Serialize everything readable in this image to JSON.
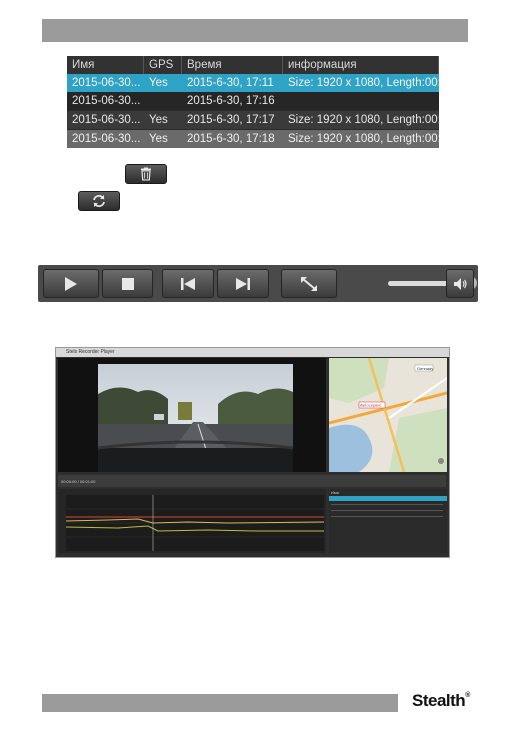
{
  "table": {
    "columns": [
      "Имя",
      "GPS",
      "Время",
      "информация"
    ],
    "rows": [
      {
        "name": "2015-06-30...",
        "gps": "Yes",
        "time": "2015-6-30, 17:11",
        "info": "Size: 1920 x 1080, Length:00:"
      },
      {
        "name": "2015-06-30...",
        "gps": "",
        "time": "2015-6-30, 17:16",
        "info": ""
      },
      {
        "name": "2015-06-30...",
        "gps": "Yes",
        "time": "2015-6-30, 17:17",
        "info": "Size: 1920 x 1080, Length:00:0"
      },
      {
        "name": "2015-06-30...",
        "gps": "Yes",
        "time": "2015-6-30, 17:18",
        "info": "Size: 1920 x 1080, Length:00:"
      }
    ],
    "selected_row": 0
  },
  "icons": {
    "delete": "trash-icon",
    "refresh": "refresh-icon",
    "play": "play-icon",
    "stop": "stop-icon",
    "prev": "skip-back-icon",
    "next": "skip-forward-icon",
    "fullscreen": "fullscreen-icon",
    "volume": "speaker-icon"
  },
  "player": {
    "volume_level": 0.93
  },
  "app_screenshot": {
    "title": "Stels Recorder Player",
    "map_labels": [
      "Gennady",
      "Автосервис"
    ],
    "time_readout": "00:00:00 / 00:01:00",
    "list_header": [
      "Имя",
      "GPS",
      "Время",
      "Информация"
    ]
  },
  "footer": {
    "brand": "Stealth"
  },
  "colors": {
    "selected": "#2fa3c6",
    "bar": "#9b9b9b",
    "toolbar": "#4a4a4a"
  }
}
